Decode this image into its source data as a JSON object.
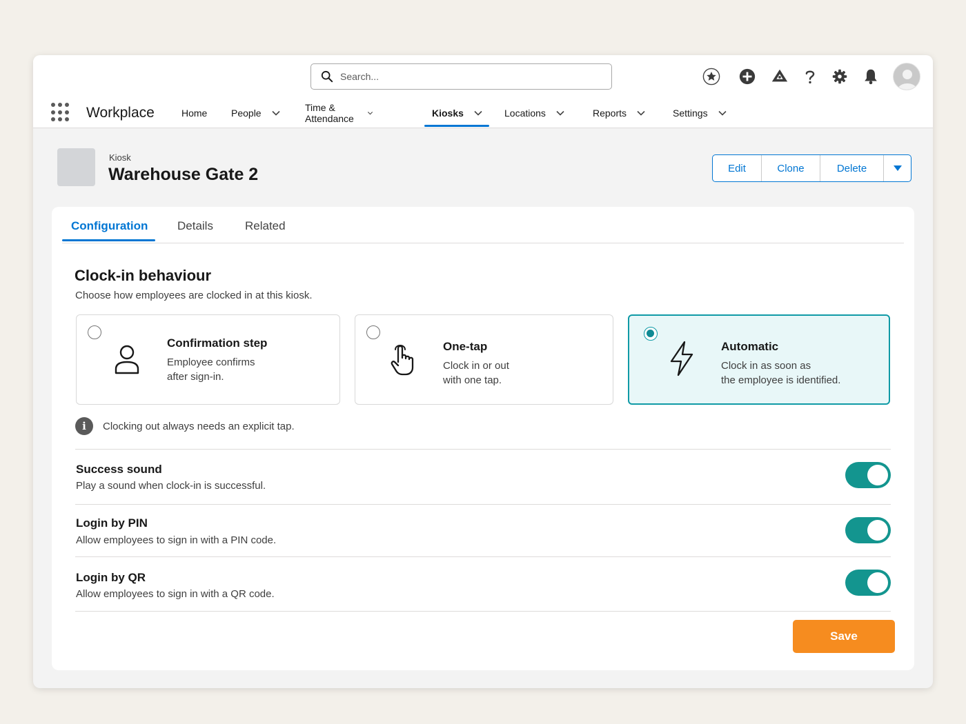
{
  "header": {
    "search_placeholder": "Search...",
    "app_name": "Workplace",
    "icons": [
      "star-icon",
      "add-icon",
      "trailhead-icon",
      "help-icon",
      "gear-icon",
      "bell-icon",
      "avatar"
    ]
  },
  "nav": {
    "items": [
      {
        "label": "Home",
        "has_menu": false
      },
      {
        "label": "People",
        "has_menu": true
      },
      {
        "label": "Time & Attendance",
        "has_menu": true
      },
      {
        "label": "Kiosks",
        "has_menu": true,
        "active": true
      },
      {
        "label": "Locations",
        "has_menu": true
      },
      {
        "label": "Reports",
        "has_menu": true
      },
      {
        "label": "Settings",
        "has_menu": true
      }
    ]
  },
  "record": {
    "type": "Kiosk",
    "title": "Warehouse Gate 2",
    "actions": [
      "Edit",
      "Clone",
      "Delete"
    ]
  },
  "tabs": [
    {
      "label": "Configuration",
      "active": true
    },
    {
      "label": "Details",
      "active": false
    },
    {
      "label": "Related",
      "active": false
    }
  ],
  "clock_in": {
    "title": "Clock-in behaviour",
    "subtitle": "Choose how employees are clocked in at this kiosk.",
    "options": [
      {
        "title": "Confirmation step",
        "desc1": "Employee confirms",
        "desc2": "after sign-in.",
        "icon": "person-icon",
        "selected": false
      },
      {
        "title": "One-tap",
        "desc1": "Clock in or out",
        "desc2": "with one tap.",
        "icon": "tap-icon",
        "selected": false
      },
      {
        "title": "Automatic",
        "desc1": "Clock in as soon as",
        "desc2": "the employee is identified.",
        "icon": "lightning-icon",
        "selected": true
      }
    ],
    "info_note": "Clocking out always needs an explicit tap."
  },
  "settings": [
    {
      "title": "Success sound",
      "desc": "Play a sound when clock-in is successful.",
      "enabled": true
    },
    {
      "title": "Login by PIN",
      "desc": "Allow employees to sign in with a PIN code.",
      "enabled": true
    },
    {
      "title": "Login by QR",
      "desc": "Allow employees to sign in with a QR code.",
      "enabled": true
    }
  ],
  "footer": {
    "save_label": "Save"
  },
  "colors": {
    "brand_blue": "#0176d3",
    "teal": "#13958f",
    "save_orange": "#f68c1f"
  }
}
